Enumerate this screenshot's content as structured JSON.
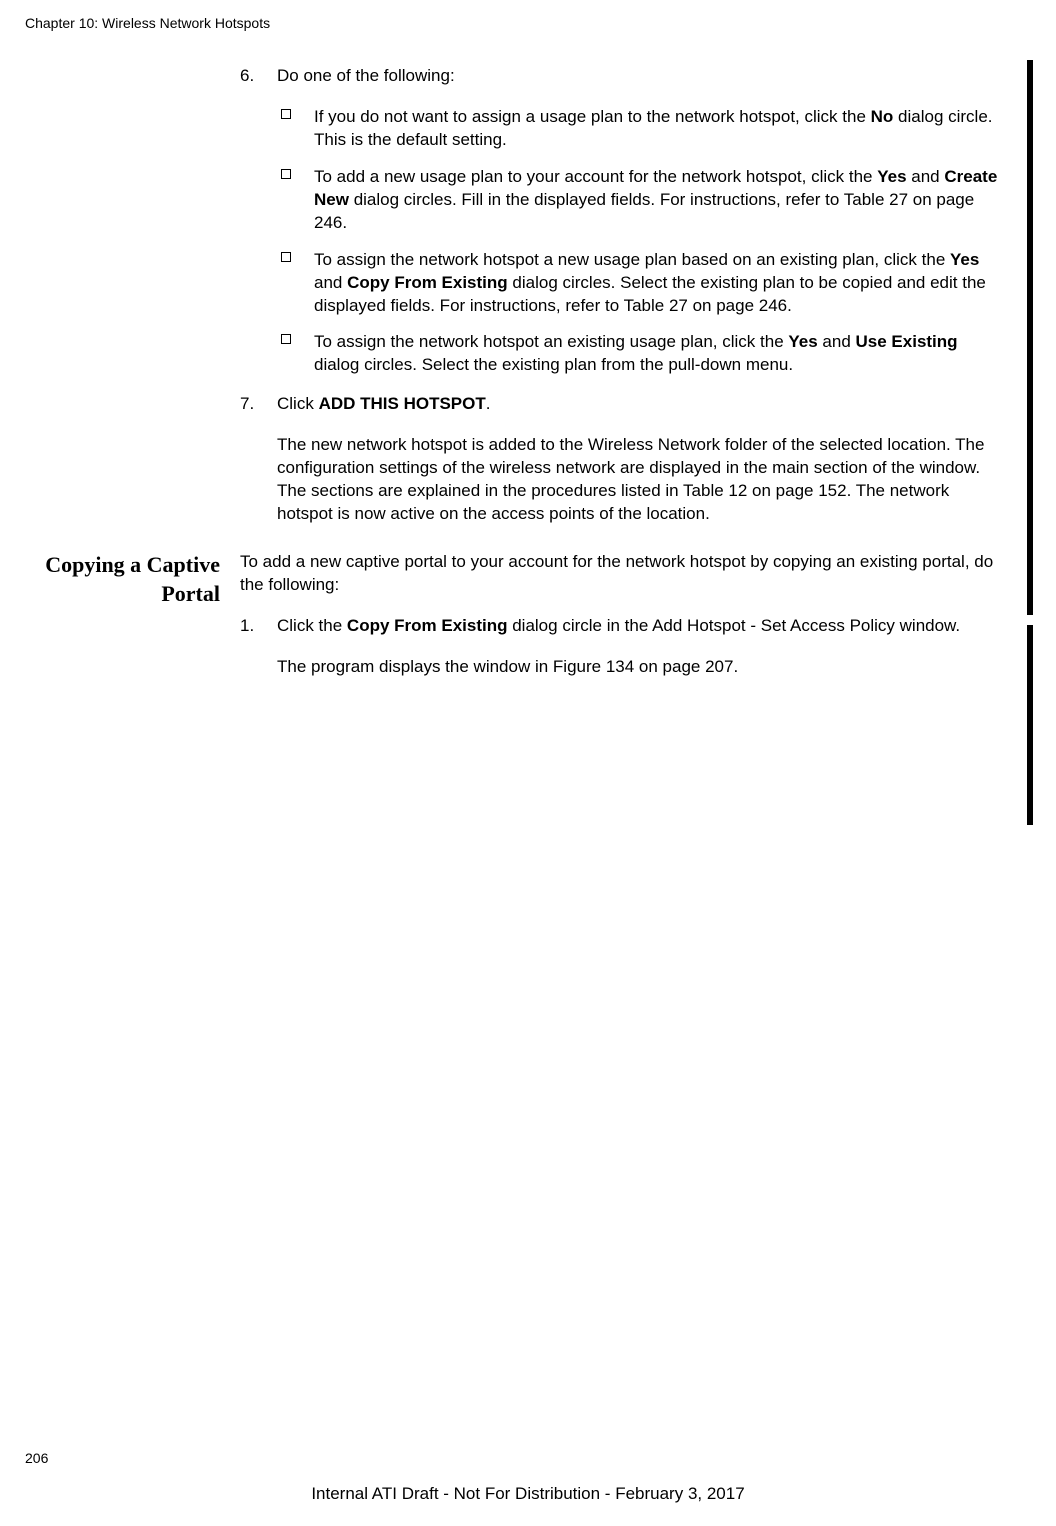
{
  "header": "Chapter 10: Wireless Network Hotspots",
  "page_number": "206",
  "footer": "Internal ATI Draft - Not For Distribution - February 3, 2017",
  "step6": {
    "number": "6.",
    "text": "Do one of the following:",
    "sub1_pre": "If you do not want to assign a usage plan to the network hotspot, click the ",
    "sub1_bold": "No",
    "sub1_post": " dialog circle. This is the default setting.",
    "sub2_pre": "To add a new usage plan to your account for the network hotspot, click the ",
    "sub2_bold1": "Yes",
    "sub2_mid": " and ",
    "sub2_bold2": "Create New",
    "sub2_post": " dialog circles. Fill in the displayed fields. For instructions, refer to Table 27 on page 246.",
    "sub3_pre": "To assign the network hotspot a new usage plan based on an existing plan, click the ",
    "sub3_bold1": "Yes",
    "sub3_mid": " and ",
    "sub3_bold2": "Copy From Existing",
    "sub3_post": " dialog circles. Select the existing plan to be copied and edit the displayed fields. For instructions, refer to Table 27 on page 246.",
    "sub4_pre": "To assign the network hotspot an existing usage plan, click the ",
    "sub4_bold1": "Yes",
    "sub4_mid": " and ",
    "sub4_bold2": "Use Existing",
    "sub4_post": " dialog circles. Select the existing plan from the pull-down menu."
  },
  "step7": {
    "number": "7.",
    "text_pre": "Click ",
    "text_bold": "ADD THIS HOTSPOT",
    "text_post": ".",
    "result": "The new network hotspot is added to the Wireless Network folder of the selected location. The configuration settings of the wireless network are displayed in the main section of the window. The sections are explained in the procedures listed in Table 12 on page 152. The network hotspot is now active on the access points of the location."
  },
  "section": {
    "title": "Copying a Captive Portal",
    "intro": "To add a new captive portal to your account for the network hotspot by copying an existing portal, do the following:",
    "step1_number": "1.",
    "step1_pre": "Click the ",
    "step1_bold": "Copy From Existing",
    "step1_post": " dialog circle in the Add Hotspot - Set Access Policy window.",
    "step1_result": "The program displays the window in Figure 134 on page 207."
  }
}
